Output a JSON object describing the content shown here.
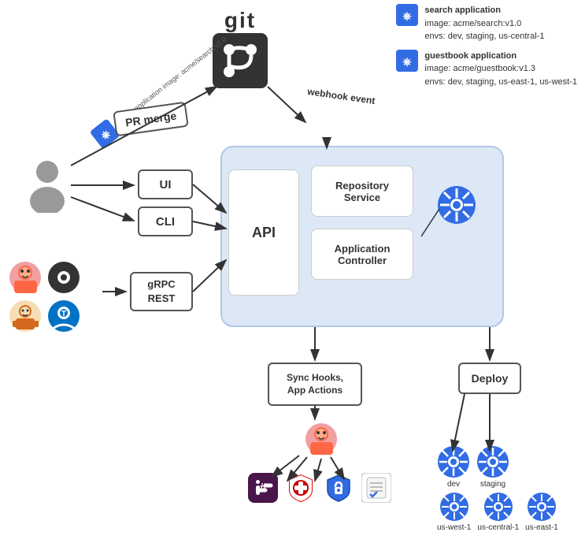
{
  "git": {
    "label": "git"
  },
  "apps": [
    {
      "title": "search application",
      "image": "image: acme/search:v1.0",
      "envs": "envs: dev, staging, us-central-1"
    },
    {
      "title": "guestbook application",
      "image": "image: acme/guestbook:v1.3",
      "envs": "envs: dev, staging, us-east-1, us-west-1"
    }
  ],
  "boxes": {
    "ui": "UI",
    "cli": "CLI",
    "grpc": "gRPC\nREST",
    "api": "API",
    "repository_service": "Repository\nService",
    "application_controller": "Application\nController",
    "sync_hooks": "Sync Hooks,\nApp Actions",
    "deploy": "Deploy"
  },
  "labels": {
    "pr_merge": "PR merge",
    "search_app_annotation": "search application\nimage: acme/search:v2.0",
    "webhook_event": "webhook\nevent"
  },
  "k8s_environments": {
    "top_right": "k8s",
    "dev": "dev",
    "staging": "staging",
    "us_west_1": "us-west-1",
    "us_central_1": "us-central-1",
    "us_east_1": "us-east-1"
  },
  "icons": {
    "slack": "slack-icon",
    "shield_red": "shield-red-icon",
    "shield_lock": "shield-lock-icon",
    "checklist": "checklist-icon",
    "robot": "robot-icon"
  },
  "colors": {
    "k8s_blue": "#326CE5",
    "container_bg": "#dde8f7",
    "container_border": "#b0c8e8",
    "arrow": "#333",
    "box_border": "#555"
  }
}
